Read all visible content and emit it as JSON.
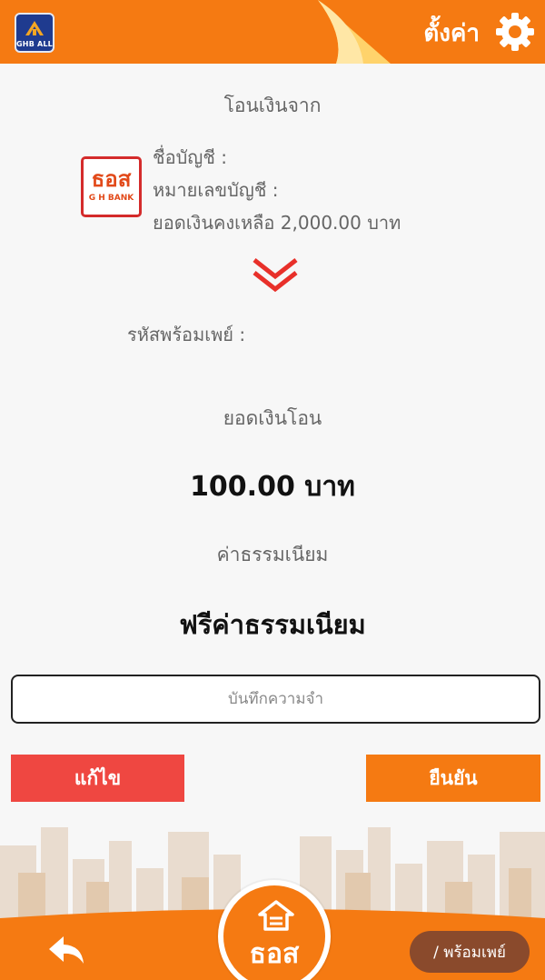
{
  "header": {
    "app_logo_text": "GHB ALL",
    "settings_label": "ตั้งค่า",
    "settings_icon": "gear-icon"
  },
  "transfer_from": {
    "title": "โอนเงินจาก",
    "bank_logo_main": "ธอส",
    "bank_logo_sub": "G H BANK",
    "account_name_label": "ชื่อบัญชี :",
    "account_number_label": "หมายเลขบัญชี :",
    "balance_line": "ยอดเงินคงเหลือ 2,000.00 บาท"
  },
  "transfer_to": {
    "arrow_icon": "double-chevron-down-icon",
    "promptpay_label": "รหัสพร้อมเพย์ :"
  },
  "amount": {
    "label": "ยอดเงินโอน",
    "value": "100.00 บาท"
  },
  "fee": {
    "label": "ค่าธรรมเนียม",
    "value": "ฟรีค่าธรรมเนียม"
  },
  "memo": {
    "placeholder": "บันทึกความจำ",
    "value": ""
  },
  "actions": {
    "edit_label": "แก้ไข",
    "confirm_label": "ยืนยัน"
  },
  "bottom_nav": {
    "back_icon": "back-arrow-icon",
    "home_label": "ธอส",
    "promptpay_button_label": "/ พร้อมเพย์"
  },
  "colors": {
    "brand_orange": "#f57a12",
    "edit_red": "#ef4741",
    "promptpay_brown": "#8a4a2c"
  }
}
